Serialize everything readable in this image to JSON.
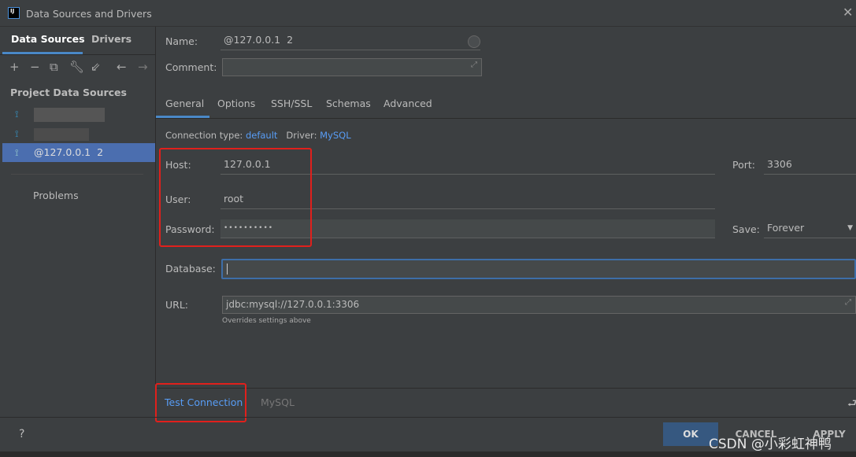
{
  "window": {
    "title": "Data Sources and Drivers",
    "logo": "IJ"
  },
  "left": {
    "tabs": [
      "Data Sources",
      "Drivers"
    ],
    "section": "Project Data Sources",
    "items": [
      "@127.0.0.1  2"
    ],
    "problems": "Problems",
    "toolbar_icons": [
      "add-icon",
      "remove-icon",
      "copy-icon",
      "wrench-icon",
      "import-icon",
      "back-icon",
      "forward-icon"
    ]
  },
  "form": {
    "name_label": "Name:",
    "name_value": "@127.0.0.1  2",
    "comment_label": "Comment:",
    "tabs": [
      "General",
      "Options",
      "SSH/SSL",
      "Schemas",
      "Advanced"
    ],
    "conn_type_label": "Connection type:",
    "conn_type": "default",
    "driver_label": "Driver:",
    "driver": "MySQL",
    "host_label": "Host:",
    "host": "127.0.0.1",
    "port_label": "Port:",
    "port": "3306",
    "user_label": "User:",
    "user": "root",
    "password_label": "Password:",
    "password": "••••••••••",
    "save_label": "Save:",
    "save": "Forever",
    "database_label": "Database:",
    "database": "",
    "url_label": "URL:",
    "url": "jdbc:mysql://127.0.0.1:3306",
    "url_hint": "Overrides settings above"
  },
  "bottom": {
    "test_connection": "Test Connection",
    "driver": "MySQL",
    "help": "?",
    "ok": "OK",
    "cancel": "CANCEL",
    "apply": "APPLY",
    "watermark": "CSDN @小彩虹神鸭"
  },
  "colors": {
    "accent": "#589df6",
    "selection": "#4b6eaf",
    "highlight": "#e0201c"
  }
}
